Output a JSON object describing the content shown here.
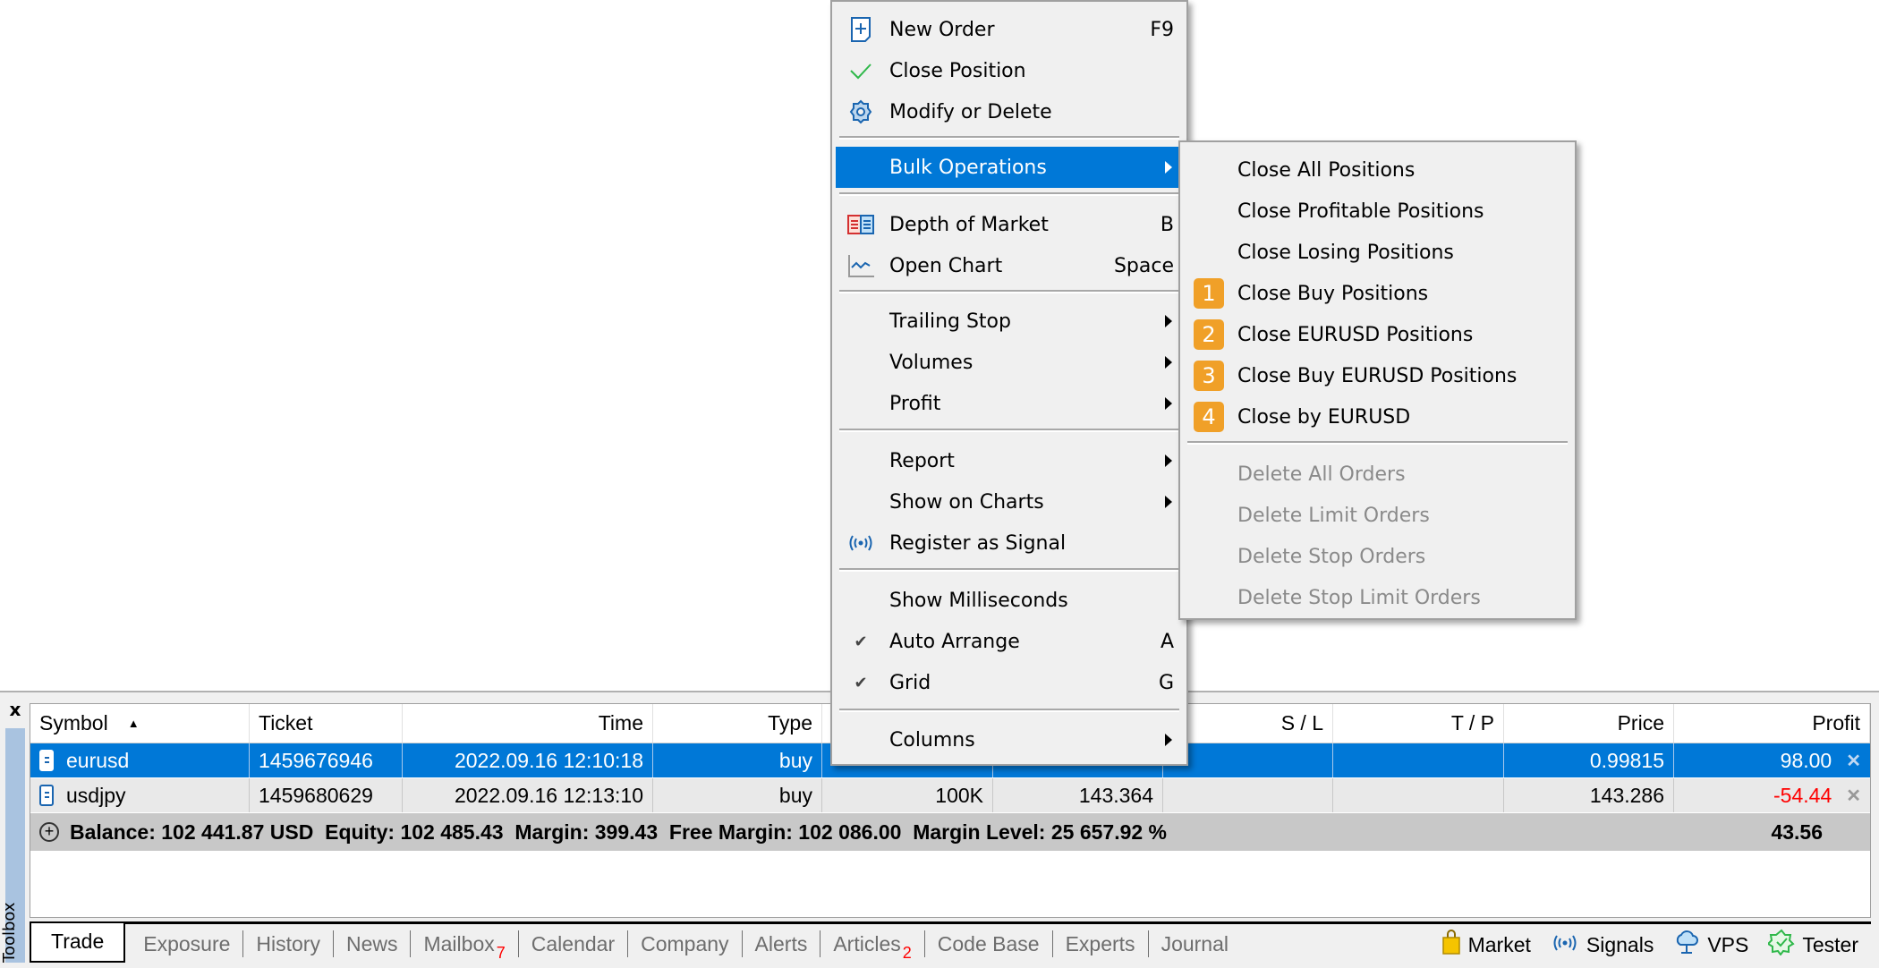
{
  "context_menu": {
    "items": [
      {
        "label": "New Order",
        "shortcut": "F9",
        "icon": "new-order-icon"
      },
      {
        "label": "Close Position",
        "icon": "checkmark-icon"
      },
      {
        "label": "Modify or Delete",
        "icon": "gear-icon"
      },
      {
        "label": "Bulk Operations",
        "submenu": true,
        "highlighted": true
      },
      {
        "label": "Depth of Market",
        "shortcut": "B",
        "icon": "depth-of-market-icon"
      },
      {
        "label": "Open Chart",
        "shortcut": "Space",
        "icon": "chart-icon"
      },
      {
        "label": "Trailing Stop",
        "submenu": true
      },
      {
        "label": "Volumes",
        "submenu": true
      },
      {
        "label": "Profit",
        "submenu": true
      },
      {
        "label": "Report",
        "submenu": true
      },
      {
        "label": "Show on Charts",
        "submenu": true
      },
      {
        "label": "Register as Signal",
        "icon": "signal-icon"
      },
      {
        "label": "Show Milliseconds"
      },
      {
        "label": "Auto Arrange",
        "shortcut": "A",
        "checked": true
      },
      {
        "label": "Grid",
        "shortcut": "G",
        "checked": true
      },
      {
        "label": "Columns",
        "submenu": true
      }
    ]
  },
  "bulk_submenu": {
    "items": [
      {
        "label": "Close All Positions"
      },
      {
        "label": "Close Profitable Positions"
      },
      {
        "label": "Close Losing Positions"
      },
      {
        "label": "Close Buy Positions",
        "badge": "1"
      },
      {
        "label": "Close EURUSD Positions",
        "badge": "2"
      },
      {
        "label": "Close Buy EURUSD Positions",
        "badge": "3"
      },
      {
        "label": "Close by EURUSD",
        "badge": "4"
      },
      {
        "label": "Delete All Orders",
        "disabled": true
      },
      {
        "label": "Delete Limit Orders",
        "disabled": true
      },
      {
        "label": "Delete Stop Orders",
        "disabled": true
      },
      {
        "label": "Delete Stop Limit Orders",
        "disabled": true
      }
    ],
    "badge_color": "#f0a028"
  },
  "toolbox": {
    "title": "Toolbox",
    "close_label": "x",
    "columns": [
      "Symbol",
      "Ticket",
      "Time",
      "Type",
      "",
      "",
      "S / L",
      "T / P",
      "Price",
      "Profit"
    ],
    "sort_indicator": "▲",
    "rows": [
      {
        "symbol": "eurusd",
        "ticket": "1459676946",
        "time": "2022.09.16 12:10:18",
        "type": "buy",
        "volume": "",
        "open_price": "",
        "sl": "",
        "tp": "",
        "price": "0.99815",
        "profit": "98.00",
        "selected": true
      },
      {
        "symbol": "usdjpy",
        "ticket": "1459680629",
        "time": "2022.09.16 12:13:10",
        "type": "buy",
        "volume": "100K",
        "open_price": "143.364",
        "sl": "",
        "tp": "",
        "price": "143.286",
        "profit": "-54.44"
      }
    ],
    "summary": {
      "text": "Balance: 102 441.87 USD  Equity: 102 485.43  Margin: 399.43  Free Margin: 102 086.00  Margin Level: 25 657.92 %",
      "total_profit": "43.56"
    },
    "tabs": [
      {
        "label": "Trade",
        "active": true
      },
      {
        "label": "Exposure"
      },
      {
        "label": "History"
      },
      {
        "label": "News"
      },
      {
        "label": "Mailbox",
        "badge": "7"
      },
      {
        "label": "Calendar"
      },
      {
        "label": "Company"
      },
      {
        "label": "Alerts"
      },
      {
        "label": "Articles",
        "badge": "2"
      },
      {
        "label": "Code Base"
      },
      {
        "label": "Experts"
      },
      {
        "label": "Journal"
      }
    ],
    "services": [
      {
        "label": "Market",
        "icon": "shopping-bag-icon"
      },
      {
        "label": "Signals",
        "icon": "signal-icon"
      },
      {
        "label": "VPS",
        "icon": "cloud-icon"
      },
      {
        "label": "Tester",
        "icon": "tester-star-icon"
      }
    ]
  },
  "colors": {
    "selection": "#0078d7",
    "negative_profit": "#ff0000",
    "menu_bg": "#f0f0f0",
    "disabled_text": "#8a8a8a"
  }
}
